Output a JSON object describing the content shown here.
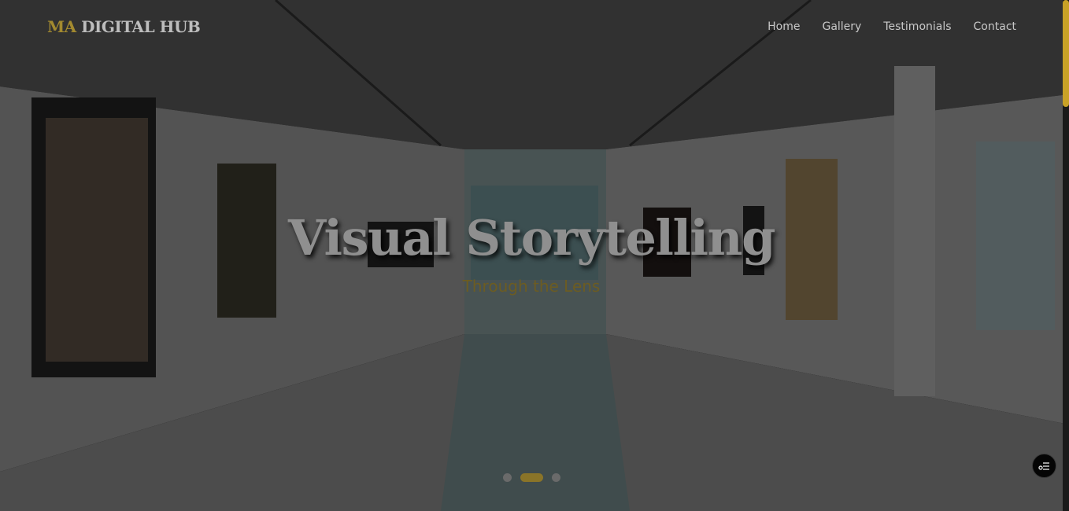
{
  "brand": {
    "accent": "MA",
    "name": "DIGITAL HUB"
  },
  "nav": {
    "items": [
      {
        "label": "Home"
      },
      {
        "label": "Gallery"
      },
      {
        "label": "Testimonials"
      },
      {
        "label": "Contact"
      }
    ]
  },
  "hero": {
    "title": "Visual Storytelling",
    "subtitle": "Through the Lens"
  },
  "slider": {
    "total": 3,
    "active_index": 2
  },
  "widget": {
    "icon": "settings-sliders-icon"
  },
  "colors": {
    "accent": "#c9a227",
    "subtitle": "#6c5c22",
    "nav_text": "#c8c8c8"
  }
}
